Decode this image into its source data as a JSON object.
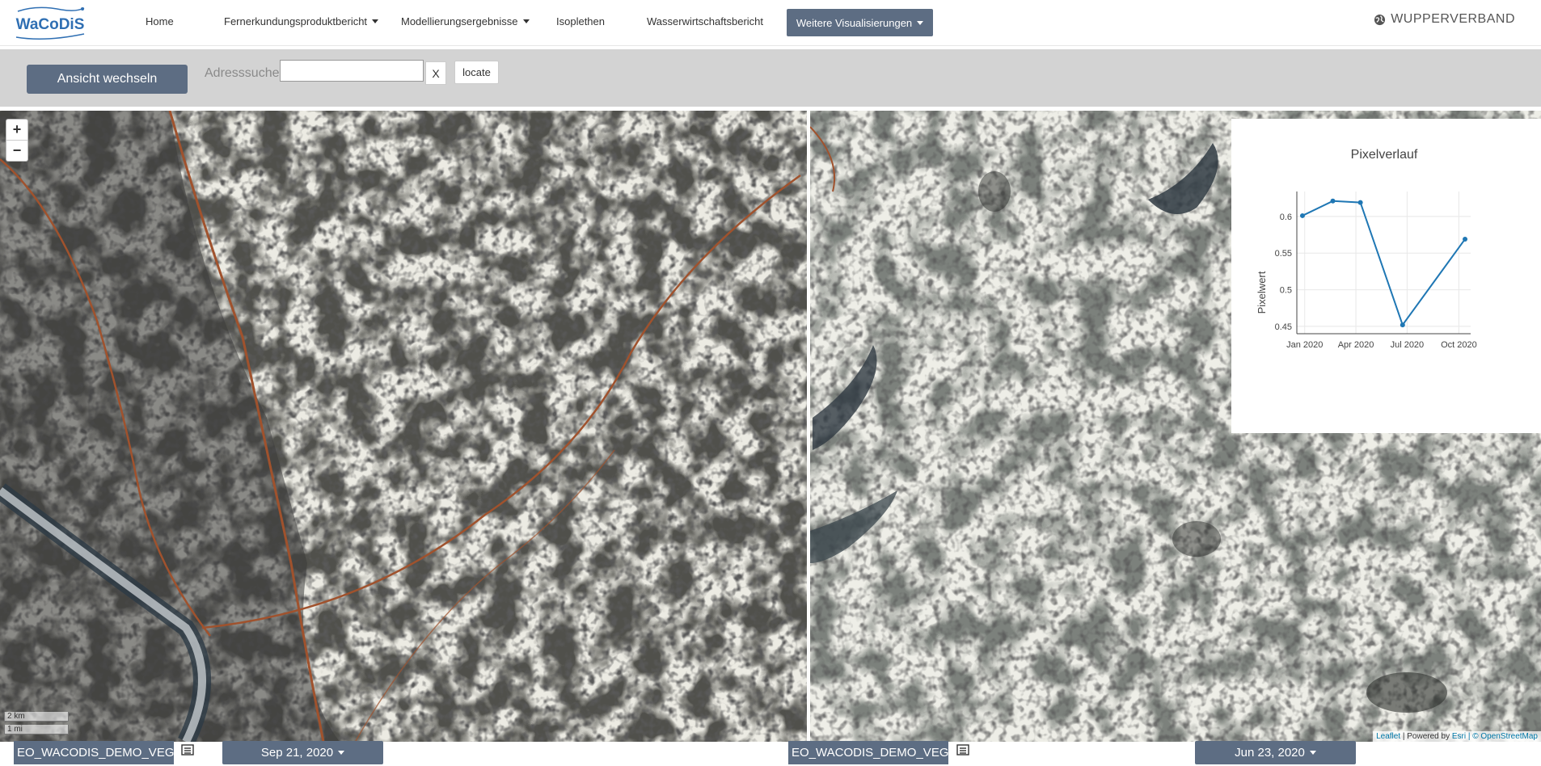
{
  "nav": {
    "logo_text": "WaCoDiS",
    "items": [
      {
        "label": "Home",
        "dropdown": false
      },
      {
        "label": "Fernerkundungsproduktbericht",
        "dropdown": true
      },
      {
        "label": "Modellierungsergebnisse",
        "dropdown": true
      },
      {
        "label": "Isoplethen",
        "dropdown": false
      },
      {
        "label": "Wasserwirtschaftsbericht",
        "dropdown": false
      }
    ],
    "active_button": "Weitere Visualisierungen",
    "brand_right": "WUPPERVERBAND",
    "brand_icon": "globe-icon"
  },
  "toolbar": {
    "toggle_view_label": "Ansicht wechseln",
    "address_label": "Adresssuche",
    "address_value": "",
    "clear_label": "X",
    "locate_label": "locate"
  },
  "map": {
    "zoom_in": "+",
    "zoom_out": "−",
    "scale_km": "2 km",
    "scale_mi": "1 mi",
    "attribution": {
      "leaflet": "Leaflet",
      "powered": "| Powered by",
      "esri": "Esri",
      "osm": "| © OpenStreetMap"
    }
  },
  "chart_data": {
    "type": "line",
    "title": "Pixelverlauf",
    "ylabel": "Pixelwert",
    "xlabel": "",
    "x_ticks": [
      "Jan 2020",
      "Apr 2020",
      "Jul 2020",
      "Oct 2020"
    ],
    "y_ticks": [
      0.45,
      0.5,
      0.55,
      0.6
    ],
    "ylim": [
      0.44,
      0.634
    ],
    "xlim": [
      "2019-12-18",
      "2020-10-22"
    ],
    "grid": true,
    "color": "#1f77b4",
    "points": [
      {
        "x": "2019-12-28",
        "y": 0.601
      },
      {
        "x": "2020-02-20",
        "y": 0.621
      },
      {
        "x": "2020-04-09",
        "y": 0.619
      },
      {
        "x": "2020-06-23",
        "y": 0.452
      },
      {
        "x": "2020-10-12",
        "y": 0.569
      }
    ]
  },
  "bottom": {
    "left_layer": "EO_WACODIS_DEMO_VEGETATION",
    "left_date": "Sep 21, 2020",
    "right_layer": "EO_WACODIS_DEMO_VEGETATION",
    "right_date": "Jun 23, 2020"
  }
}
